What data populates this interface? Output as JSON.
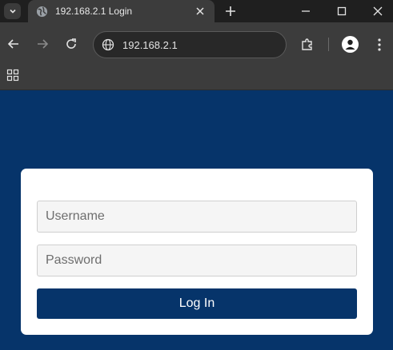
{
  "browser": {
    "tab": {
      "title": "192.168.2.1 Login",
      "favicon": "globe-icon"
    },
    "address_bar": {
      "url": "192.168.2.1",
      "site_icon": "globe-icon"
    },
    "icons": {
      "tab_search": "chevron-down-icon",
      "tab_close": "close-icon",
      "new_tab": "plus-icon",
      "back": "back-arrow-icon",
      "forward": "forward-arrow-icon",
      "reload": "reload-icon",
      "extensions": "puzzle-icon",
      "profile": "person-icon",
      "menu": "kebab-menu-icon",
      "apps": "apps-grid-icon",
      "minimize": "minimize-icon",
      "maximize": "maximize-icon",
      "close_window": "close-icon"
    }
  },
  "login": {
    "username_placeholder": "Username",
    "password_placeholder": "Password",
    "submit_label": "Log In"
  },
  "colors": {
    "page_background": "#06346a",
    "button_background": "#06346a",
    "card_background": "#ffffff",
    "tab_strip": "#1f1f1f",
    "toolbar": "#3c3c3c"
  }
}
